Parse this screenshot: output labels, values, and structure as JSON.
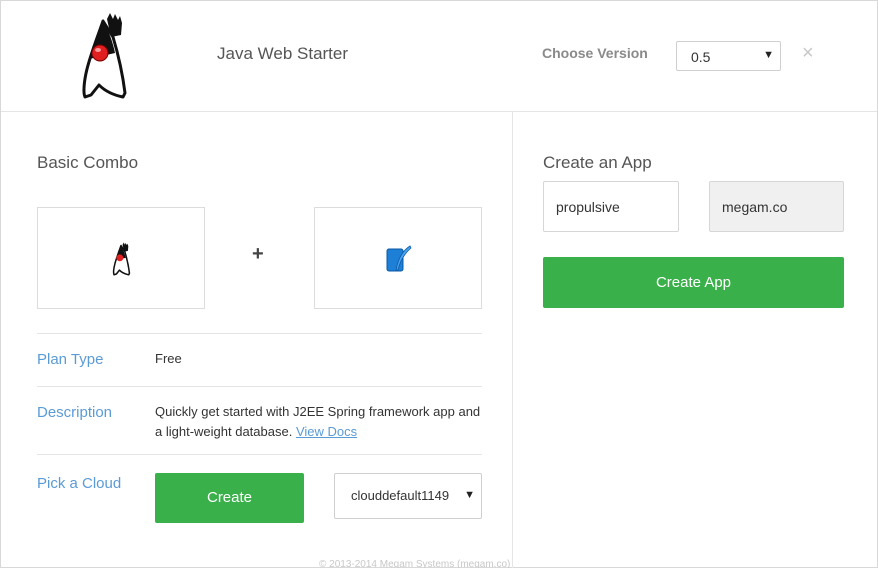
{
  "header": {
    "app_title": "Java Web Starter",
    "version_label": "Choose Version",
    "version_value": "0.5",
    "close_symbol": "×"
  },
  "basic_combo": {
    "title": "Basic Combo",
    "items": [
      {
        "icon": "java-duke-icon"
      },
      {
        "icon": "database-feather-icon"
      }
    ],
    "plus": "+"
  },
  "details": {
    "plan_type_label": "Plan Type",
    "plan_type_value": "Free",
    "description_label": "Description",
    "description_text": "Quickly get started with J2EE Spring framework app and a light-weight database.",
    "view_docs": "View Docs",
    "pick_cloud_label": "Pick a Cloud",
    "create_button": "Create",
    "cloud_value": "clouddefault1149"
  },
  "create_app": {
    "title": "Create an App",
    "app_name_value": "propulsive",
    "domain_value": "megam.co",
    "create_app_button": "Create App"
  },
  "footer": {
    "text": "© 2013-2014 Megam Systems (megam.co)"
  },
  "colors": {
    "accent_green": "#3ab04a",
    "label_blue": "#5b9bd5",
    "duke_red": "#e02020"
  }
}
